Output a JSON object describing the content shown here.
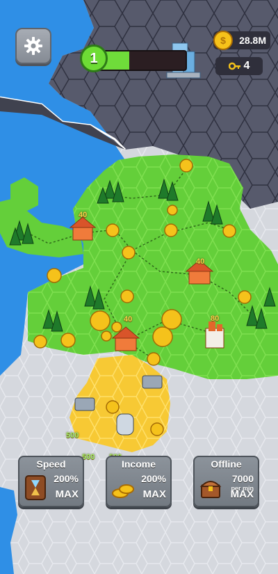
{
  "hud": {
    "level": "1",
    "level_progress": 0.38,
    "coins": "28.8M",
    "keys": "4"
  },
  "map_labels": {
    "house_top": "40",
    "house_right": "40",
    "house_center": "40",
    "factory": "80",
    "yard_left": "500",
    "yard_bottom1": "500",
    "yard_bottom2": "500"
  },
  "boosts": {
    "speed": {
      "title": "Speed",
      "value": "200%",
      "status": "MAX"
    },
    "income": {
      "title": "Income",
      "value": "200%",
      "status": "MAX"
    },
    "offline": {
      "title": "Offline",
      "value": "7000",
      "unit": "per min",
      "status": "MAX"
    }
  },
  "colors": {
    "sea": "#2f8fe6",
    "grass": "#66d33c",
    "mountain": "#5a5c6e",
    "neutral": "#d6d9df",
    "sand": "#f9cf3a"
  }
}
